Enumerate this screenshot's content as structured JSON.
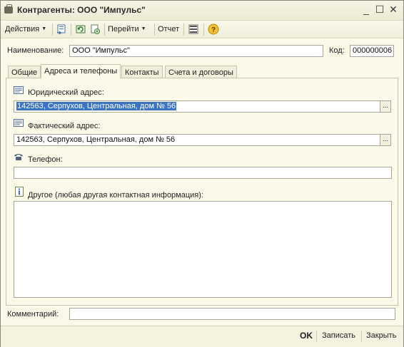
{
  "window": {
    "title": "Контрагенты: ООО \"Импульс\""
  },
  "toolbar": {
    "actions_label": "Действия",
    "goto_label": "Перейти",
    "report_label": "Отчет",
    "help_glyph": "?"
  },
  "form": {
    "name_label": "Наименование:",
    "name_value": "ООО \"Импульс\"",
    "code_label": "Код:",
    "code_value": "000000006",
    "comment_label": "Комментарий:",
    "comment_value": ""
  },
  "tabs": [
    {
      "label": "Общие"
    },
    {
      "label": "Адреса и телефоны"
    },
    {
      "label": "Контакты"
    },
    {
      "label": "Счета и договоры"
    }
  ],
  "addresses": {
    "legal_label": "Юридический адрес:",
    "legal_value": "142563, Серпухов, Центральная, дом № 56",
    "actual_label": "Фактический адрес:",
    "actual_value": "142563, Серпухов, Центральная, дом № 56",
    "phone_label": "Телефон:",
    "phone_value": "",
    "other_label": "Другое (любая другая контактная информация):",
    "other_value": "",
    "ellipsis": "..."
  },
  "footer": {
    "ok_label": "OK",
    "save_label": "Записать",
    "close_label": "Закрыть"
  }
}
